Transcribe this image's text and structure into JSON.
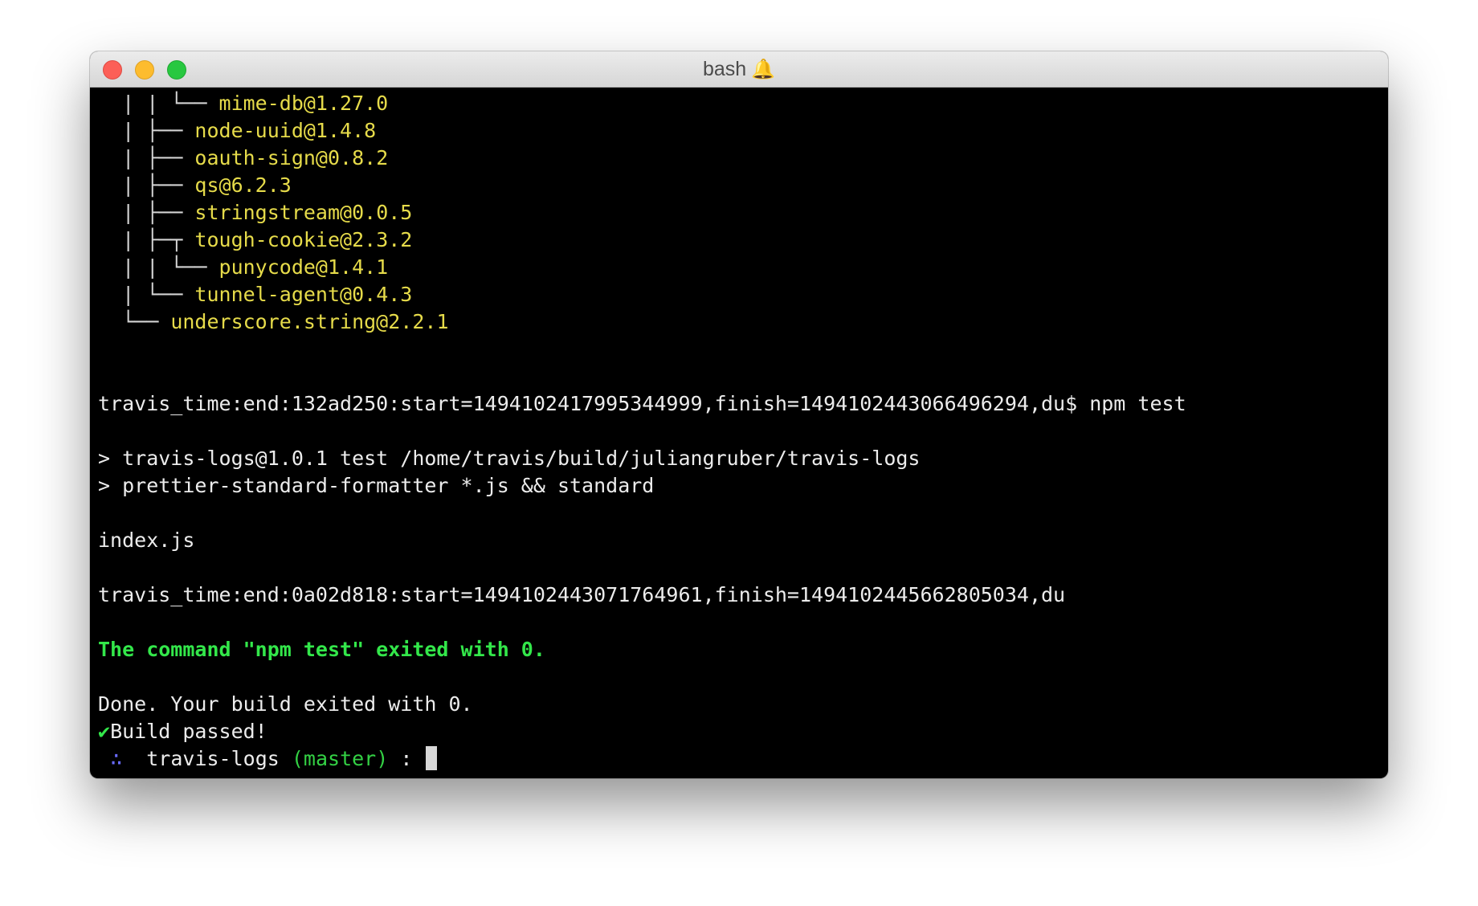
{
  "window": {
    "title": "bash",
    "title_icon": "bell-icon",
    "controls": [
      "close",
      "minimize",
      "maximize"
    ]
  },
  "dependency_tree": [
    {
      "prefix": "  | | └── ",
      "package": "mime-db@1.27.0"
    },
    {
      "prefix": "  | ├── ",
      "package": "node-uuid@1.4.8"
    },
    {
      "prefix": "  | ├── ",
      "package": "oauth-sign@0.8.2"
    },
    {
      "prefix": "  | ├── ",
      "package": "qs@6.2.3"
    },
    {
      "prefix": "  | ├── ",
      "package": "stringstream@0.0.5"
    },
    {
      "prefix": "  | ├─┬ ",
      "package": "tough-cookie@2.3.2"
    },
    {
      "prefix": "  | | └── ",
      "package": "punycode@1.4.1"
    },
    {
      "prefix": "  | └── ",
      "package": "tunnel-agent@0.4.3"
    },
    {
      "prefix": "  └── ",
      "package": "underscore.string@2.2.1"
    }
  ],
  "output": {
    "travis_time_1": "travis_time:end:132ad250:start=1494102417995344999,finish=1494102443066496294,du$ npm test",
    "npm_script_1": "> travis-logs@1.0.1 test /home/travis/build/juliangruber/travis-logs",
    "npm_script_2": "> prettier-standard-formatter *.js && standard",
    "file_line": "index.js",
    "travis_time_2": "travis_time:end:0a02d818:start=1494102443071764961,finish=1494102445662805034,du",
    "command_result": "The command \"npm test\" exited with 0.",
    "done_line": "Done. Your build exited with 0.",
    "check_mark": "✔",
    "build_passed": "Build passed!"
  },
  "prompt": {
    "glyph": "∴",
    "directory": "travis-logs",
    "branch": "(master)",
    "separator": ":"
  }
}
